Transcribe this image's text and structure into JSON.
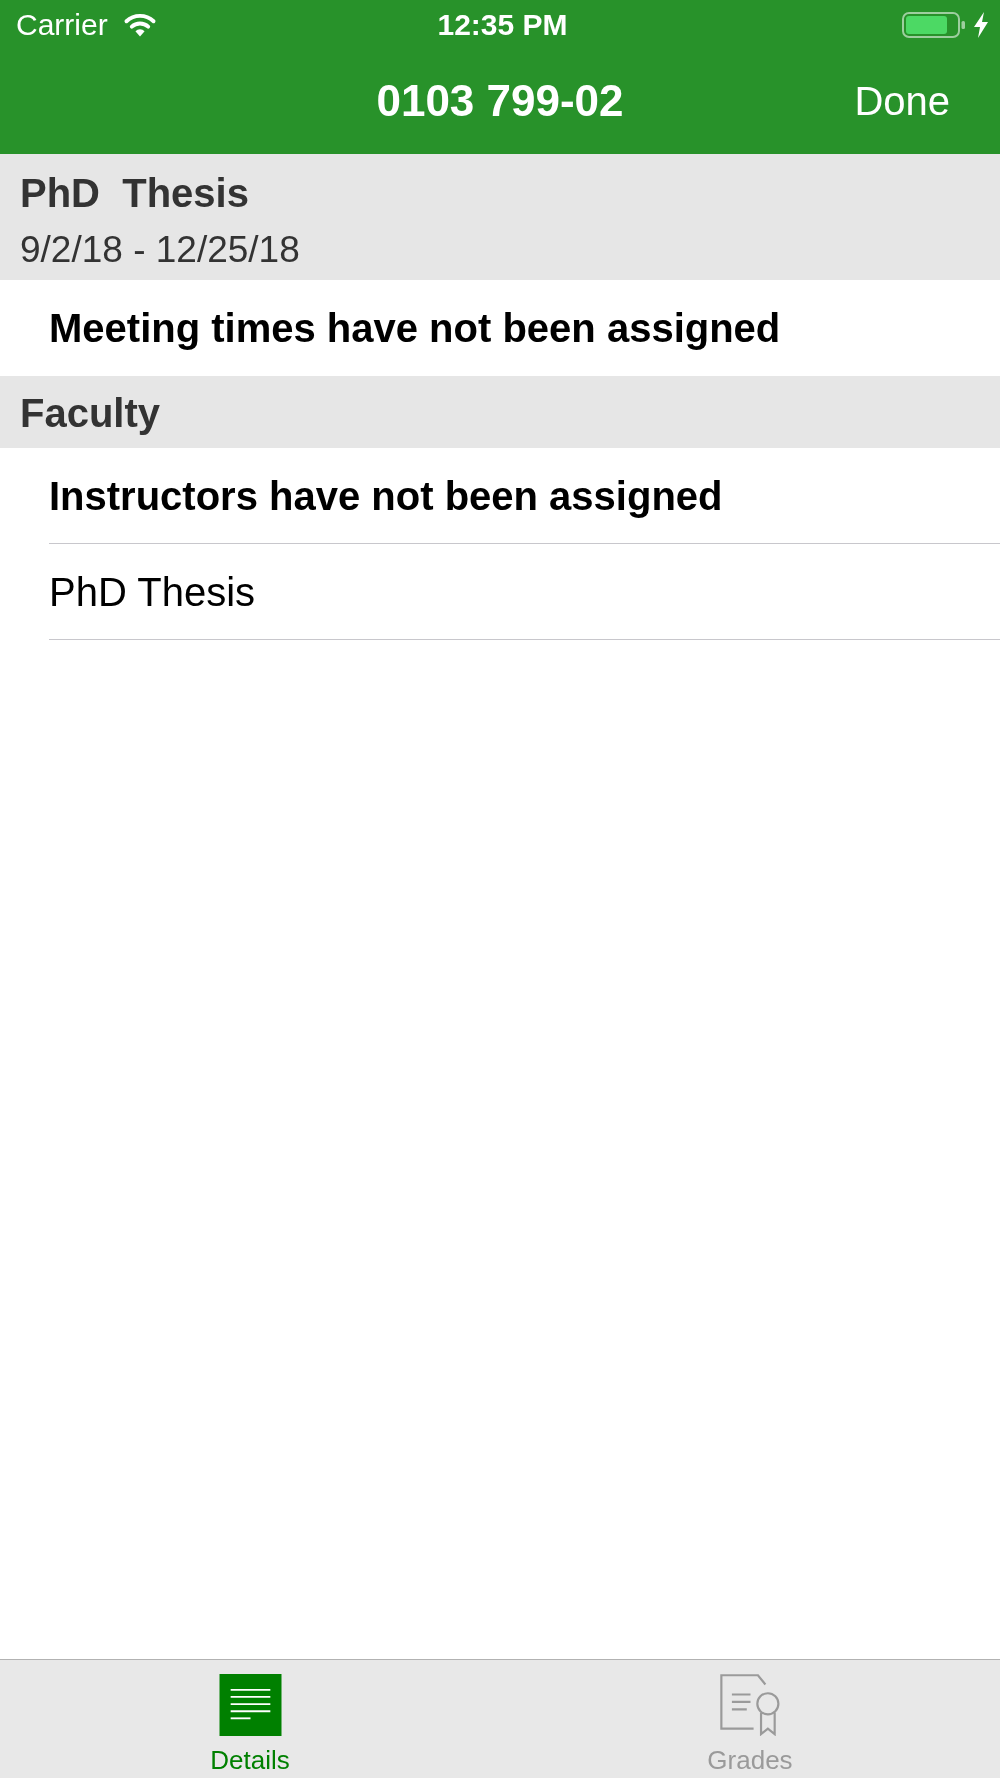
{
  "status_bar": {
    "carrier": "Carrier",
    "time": "12:35 PM",
    "charging": true
  },
  "nav_bar": {
    "title": "0103 799-02",
    "done_button": "Done"
  },
  "sections": [
    {
      "title": "PhD  Thesis",
      "subtitle": "9/2/18 - 12/25/18",
      "rows": [
        {
          "kind": "notice",
          "text": "Meeting times have not been assigned"
        }
      ]
    },
    {
      "title": "Faculty",
      "rows": [
        {
          "kind": "notice",
          "text": "Instructors have not been assigned"
        },
        {
          "kind": "item",
          "text": "PhD Thesis"
        }
      ]
    }
  ],
  "tab_bar": {
    "tabs": [
      {
        "label": "Details",
        "selected": true
      },
      {
        "label": "Grades",
        "selected": false
      }
    ]
  }
}
